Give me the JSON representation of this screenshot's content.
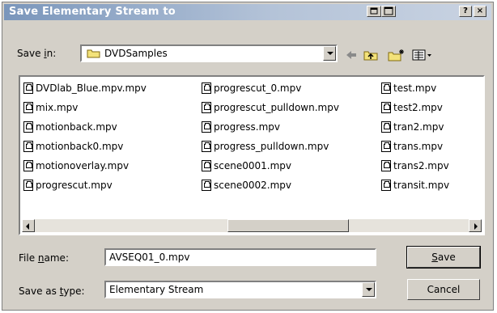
{
  "dialog": {
    "title": "Save Elementary Stream to",
    "title_buttons": [
      "?",
      "×"
    ]
  },
  "toolbar": {
    "save_in_label": {
      "pre": "Save ",
      "key": "i",
      "post": "n:"
    },
    "save_in_value": "DVDSamples",
    "icons": [
      "back-arrow-icon",
      "up-folder-icon",
      "new-folder-icon",
      "view-menu-icon"
    ]
  },
  "files": {
    "columns": [
      [
        "DVDlab_Blue.mpv.mpv",
        "mix.mpv",
        "motionback.mpv",
        "motionback0.mpv",
        "motionoverlay.mpv",
        "progrescut.mpv"
      ],
      [
        "progrescut_0.mpv",
        "progrescut_pulldown.mpv",
        "progress.mpv",
        "progress_pulldown.mpv",
        "scene0001.mpv",
        "scene0002.mpv"
      ],
      [
        "test.mpv",
        "test2.mpv",
        "tran2.mpv",
        "trans.mpv",
        "trans2.mpv",
        "transit.mpv"
      ]
    ]
  },
  "filename": {
    "label": {
      "pre": "File ",
      "key": "n",
      "post": "ame:"
    },
    "value": "AVSEQ01_0.mpv"
  },
  "savetype": {
    "label": {
      "pre": "Save as ",
      "key": "t",
      "post": "ype:"
    },
    "value": "Elementary Stream"
  },
  "buttons": {
    "save": {
      "key": "S",
      "rest": "ave"
    },
    "cancel": "Cancel"
  },
  "colors": {
    "title_gradient_start": "#7a96bb",
    "title_gradient_end": "#c9d3e2",
    "face": "#d4d0c8"
  }
}
